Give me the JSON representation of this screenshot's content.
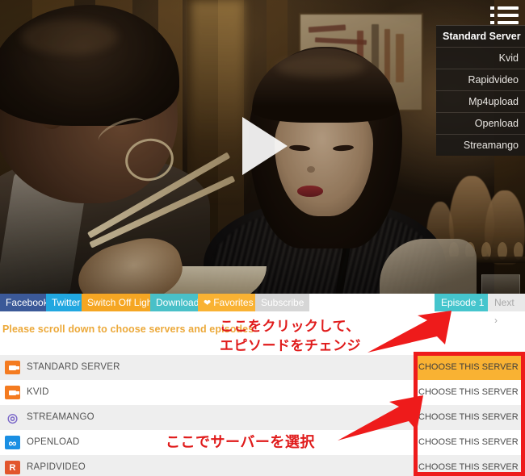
{
  "player": {
    "play_button": "play-triangle",
    "menu_icon": "hamburger-list-icon",
    "server_menu": [
      {
        "label": "Standard Server",
        "active": true
      },
      {
        "label": "Kvid",
        "active": false
      },
      {
        "label": "Rapidvideo",
        "active": false
      },
      {
        "label": "Mp4upload",
        "active": false
      },
      {
        "label": "Openload",
        "active": false
      },
      {
        "label": "Streamango",
        "active": false
      }
    ]
  },
  "toolbar": {
    "facebook": "Facebook",
    "twitter": "Twitter",
    "switch_off_light": "Switch Off Light",
    "download": "Download",
    "favorites": "Favorites",
    "favorites_icon": "heart-icon",
    "subscribe": "Subscribe",
    "episode": "Episode 1",
    "next": "Next ›"
  },
  "notice": "Please scroll down to choose servers and episodes",
  "annotations": {
    "line1": "ここをクリックして、",
    "line2": "エピソードをチェンジ",
    "line3": "ここでサーバーを選択",
    "color": "#e01b1b",
    "box_color": "#ee1b1b"
  },
  "server_list": {
    "choose_label": "CHOOSE THIS SERVER",
    "rows": [
      {
        "name": "STANDARD SERVER",
        "icon": "video-camera-icon",
        "highlighted": true
      },
      {
        "name": "KVID",
        "icon": "video-camera-icon",
        "highlighted": false
      },
      {
        "name": "STREAMANGO",
        "icon": "streamango-icon",
        "highlighted": false
      },
      {
        "name": "OPENLOAD",
        "icon": "infinity-icon",
        "highlighted": false
      },
      {
        "name": "RAPIDVIDEO",
        "icon": "rapidvideo-r-icon",
        "highlighted": false
      }
    ]
  },
  "colors": {
    "facebook": "#3b5998",
    "twitter": "#21a7e0",
    "amber": "#f5a623",
    "teal": "#45c5cd",
    "gray": "#d6d6d6",
    "notice": "#eca93a",
    "highlight": "#f9b233"
  }
}
